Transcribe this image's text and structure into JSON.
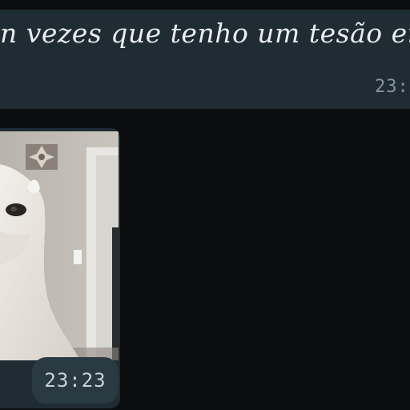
{
  "messages": [
    {
      "text": "n vezes que tenho um tesão er",
      "time": "23:"
    },
    {
      "type": "image",
      "image_description": "photo of a white dog looking at the camera indoors",
      "time": "23:23"
    }
  ],
  "colors": {
    "background": "#0b0d0e",
    "bubble": "#1f2c33",
    "text": "#e9edef",
    "time": "#8696a0"
  }
}
